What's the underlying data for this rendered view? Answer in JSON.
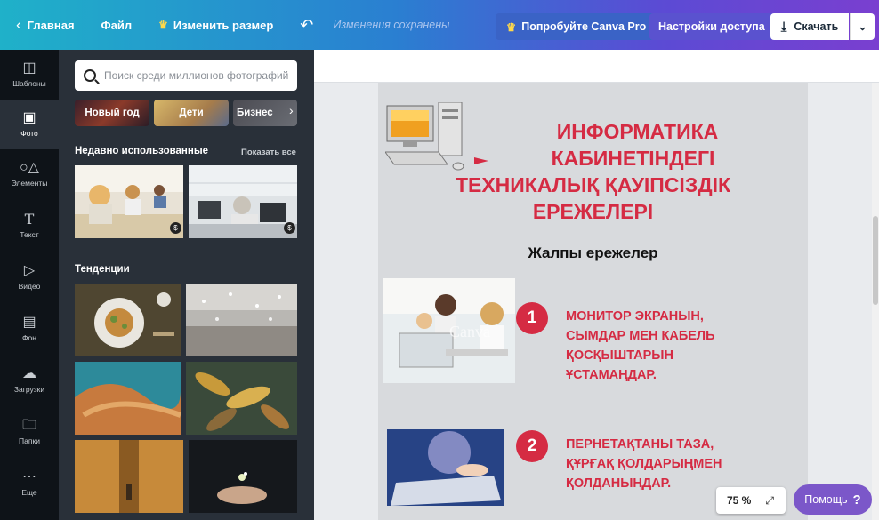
{
  "topbar": {
    "home_label": "Главная",
    "file_label": "Файл",
    "resize_label": "Изменить размер",
    "saved_status": "Изменения сохранены",
    "pro_label": "Попробуйте Canva Pro",
    "access_label": "Настройки доступа",
    "download_label": "Скачать"
  },
  "rail": {
    "items": [
      {
        "label": "Шаблоны",
        "icon": "templates-icon"
      },
      {
        "label": "Фото",
        "icon": "photo-icon"
      },
      {
        "label": "Элементы",
        "icon": "elements-icon"
      },
      {
        "label": "Текст",
        "icon": "text-icon"
      },
      {
        "label": "Видео",
        "icon": "video-icon"
      },
      {
        "label": "Фон",
        "icon": "background-icon"
      },
      {
        "label": "Загрузки",
        "icon": "upload-icon"
      },
      {
        "label": "Папки",
        "icon": "folder-icon"
      },
      {
        "label": "Еще",
        "icon": "more-icon"
      }
    ],
    "active_index": 1
  },
  "panel": {
    "search_placeholder": "Поиск среди миллионов фотографий",
    "chips": [
      "Новый год",
      "Дети",
      "Бизнес"
    ],
    "recent_title": "Недавно использованные",
    "show_all": "Показать все",
    "trends_title": "Тенденции",
    "badge": "$"
  },
  "poster": {
    "title_line1": "ИНФОРМАТИКА",
    "title_line2": "КАБИНЕТІНДЕГІ",
    "title_line3": "ТЕХНИКАЛЫҚ ҚАУІПСІЗДІК",
    "title_line4": "ЕРЕЖЕЛЕРІ",
    "subtitle": "Жалпы ережелер",
    "rules": [
      {
        "num": "1",
        "line1": "МОНИТОР ЭКРАНЫН,",
        "line2": "СЫМДАР МЕН КАБЕЛЬ",
        "line3": "ҚОСҚЫШТАРЫН",
        "line4": "ҰСТАМАҢДАР."
      },
      {
        "num": "2",
        "line1": "ПЕРНЕТАҚТАНЫ ТАЗА,",
        "line2": "ҚҰРҒАҚ ҚОЛДАРЫҢМЕН",
        "line3": "ҚОЛДАНЫҢДАР."
      }
    ],
    "watermark": "Canva"
  },
  "footer": {
    "zoom": "75 %",
    "help_label": "Помощь",
    "help_symbol": "?"
  },
  "colors": {
    "accent_red": "#d52b43",
    "panel_bg": "#293039",
    "rail_bg": "#0e1318",
    "help_purple": "#7b57c9"
  }
}
